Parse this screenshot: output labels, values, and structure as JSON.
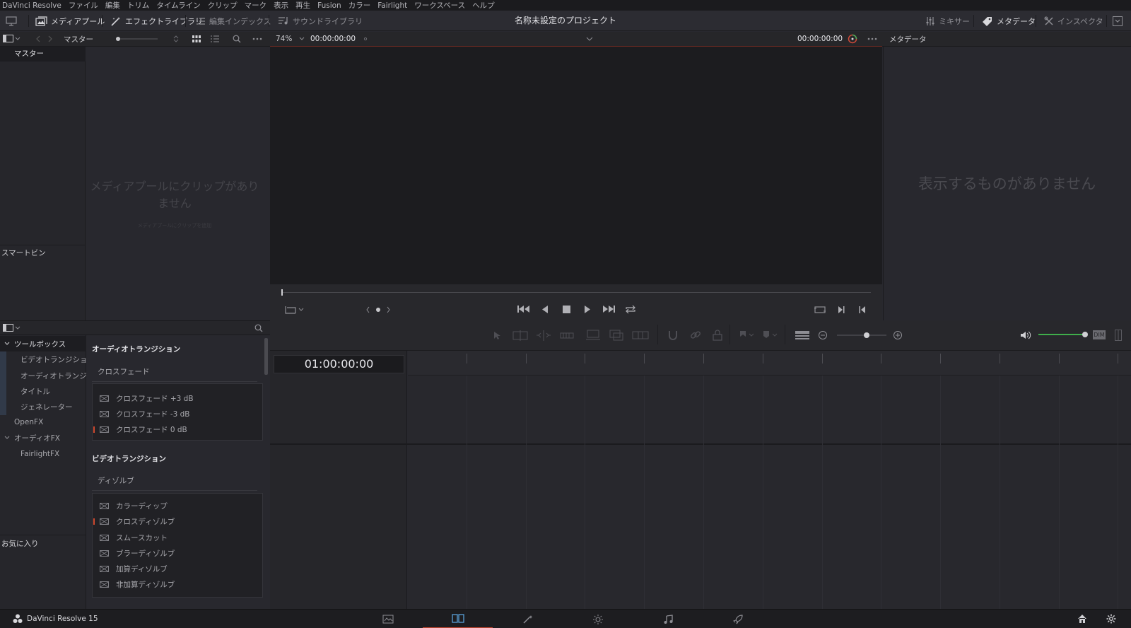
{
  "menu": [
    "DaVinci Resolve",
    "ファイル",
    "編集",
    "トリム",
    "タイムライン",
    "クリップ",
    "マーク",
    "表示",
    "再生",
    "Fusion",
    "カラー",
    "Fairlight",
    "ワークスペース",
    "ヘルプ"
  ],
  "toolbar": {
    "media_pool": "メディアプール",
    "effects_library": "エフェクトライブラリ",
    "edit_index": "編集インデックス",
    "sound_library": "サウンドライブラリ",
    "project_title": "名称未設定のプロジェクト",
    "mixer": "ミキサー",
    "metadata": "メタデータ",
    "inspector": "インスペクタ"
  },
  "subbar": {
    "bin_name": "マスター",
    "zoom": "74%",
    "timecode_left": "00:00:00:00",
    "timecode_right": "00:00:00:00",
    "metadata_title": "メタデータ"
  },
  "bins": {
    "master": "マスター",
    "smart_bins": "スマートビン"
  },
  "media_pool": {
    "empty_message": "メディアプールにクリップがありません",
    "empty_hint": "メディアプールにクリップを追加"
  },
  "metadata": {
    "empty_message": "表示するものがありません"
  },
  "effects": {
    "tree": {
      "toolbox": "ツールボックス",
      "video_transitions": "ビデオトランジション",
      "audio_transitions": "オーディオトランジ...",
      "titles": "タイトル",
      "generators": "ジェネレーター",
      "openfx": "OpenFX",
      "audio_fx": "オーディオFX",
      "fairlight_fx": "FairlightFX"
    },
    "favorites": "お気に入り",
    "audio_group": {
      "title": "オーディオトランジション",
      "subtitle": "クロスフェード",
      "items": [
        "クロスフェード +3 dB",
        "クロスフェード -3 dB",
        "クロスフェード 0 dB"
      ]
    },
    "video_group": {
      "title": "ビデオトランジション",
      "subtitle": "ディゾルブ",
      "items": [
        "カラーディップ",
        "クロスディゾルブ",
        "スムースカット",
        "ブラーディゾルブ",
        "加算ディゾルブ",
        "非加算ディゾルブ"
      ]
    }
  },
  "timeline": {
    "timecode": "01:00:00:00",
    "dim_label": "DIM"
  },
  "pagebar": {
    "product": "DaVinci Resolve 15"
  },
  "colors": {
    "accent_red": "#c5472f",
    "volume_green": "#3fae4b"
  }
}
